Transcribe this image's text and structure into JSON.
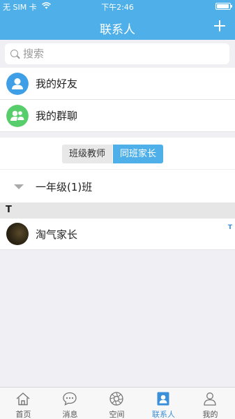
{
  "status_bar": {
    "carrier": "无 SIM 卡",
    "time": "下午2:46"
  },
  "header": {
    "title": "联系人"
  },
  "search": {
    "placeholder": "搜索"
  },
  "quick_rows": [
    {
      "label": "我的好友",
      "icon": "friend-icon",
      "color": "#3e9fe6"
    },
    {
      "label": "我的群聊",
      "icon": "group-chat-icon",
      "color": "#58cd6b"
    }
  ],
  "segments": {
    "left": "班级教师",
    "right": "同班家长",
    "active": "right"
  },
  "class_group": {
    "label": "一年级(1)班"
  },
  "section": {
    "letter": "T"
  },
  "contact": {
    "name": "淘气家长"
  },
  "index_bar": {
    "letter": "T"
  },
  "tabs": [
    {
      "label": "首页",
      "icon": "home-icon"
    },
    {
      "label": "消息",
      "icon": "message-icon"
    },
    {
      "label": "空间",
      "icon": "space-icon"
    },
    {
      "label": "联系人",
      "icon": "contacts-icon",
      "active": true
    },
    {
      "label": "我的",
      "icon": "profile-icon"
    }
  ],
  "colors": {
    "accent": "#4fb0e9",
    "active_tab": "#3b8fd9"
  }
}
